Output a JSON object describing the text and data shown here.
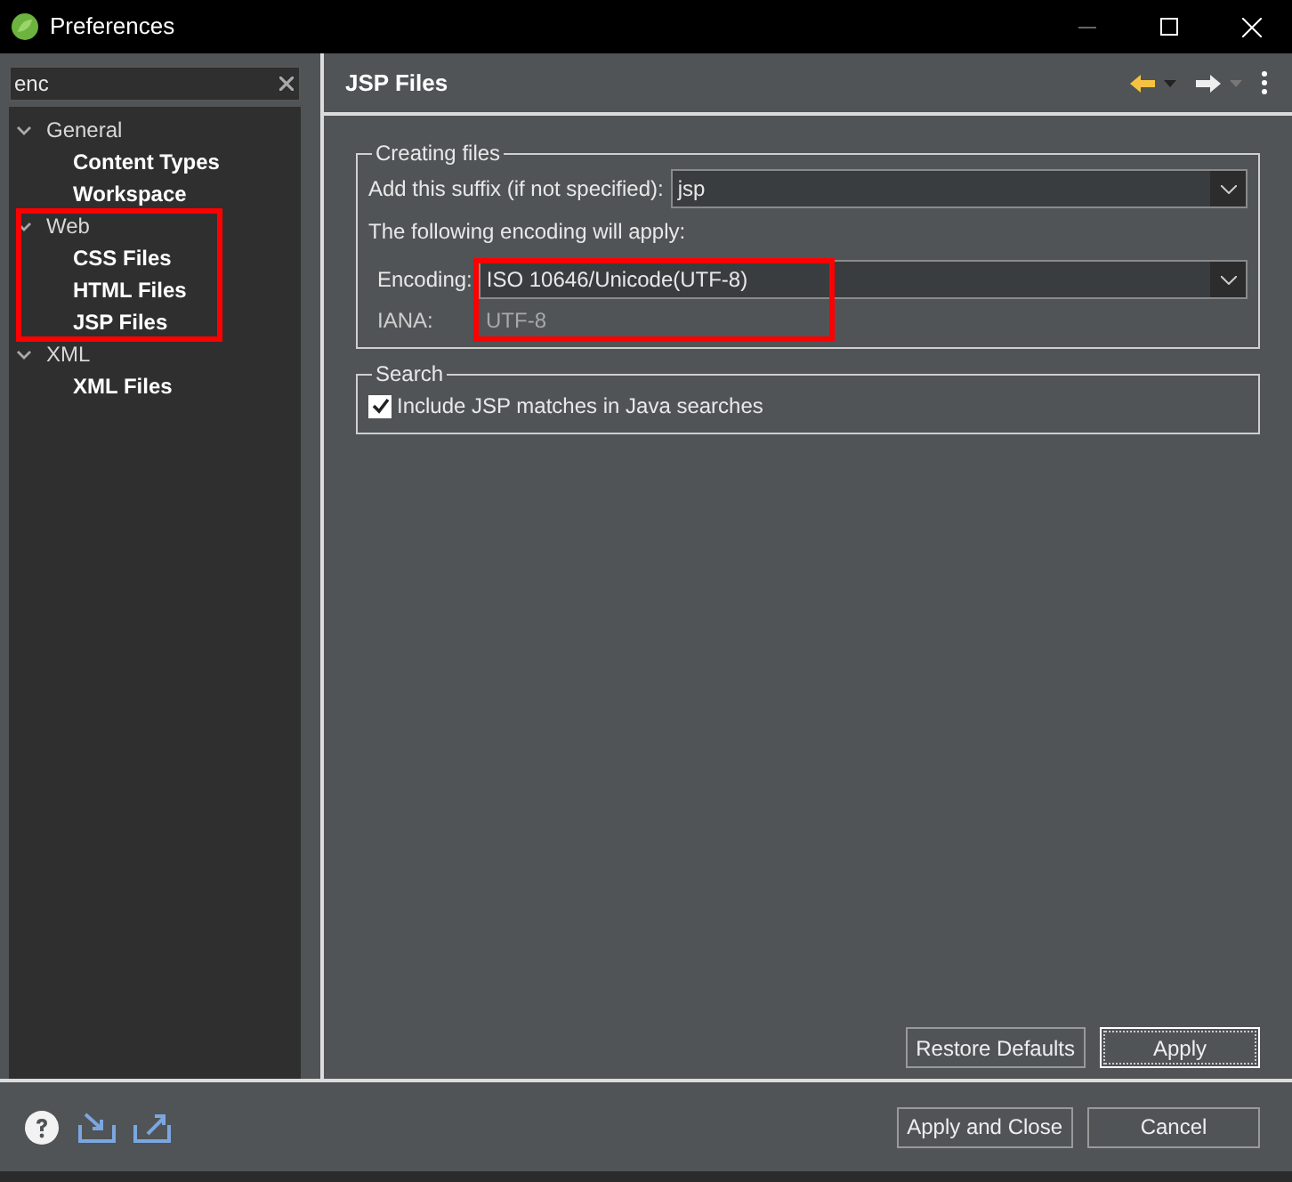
{
  "window": {
    "title": "Preferences"
  },
  "filter": {
    "value": "enc"
  },
  "tree": [
    {
      "label": "General",
      "expanded": true,
      "children": [
        {
          "label": "Content Types"
        },
        {
          "label": "Workspace"
        }
      ]
    },
    {
      "label": "Web",
      "expanded": true,
      "children": [
        {
          "label": "CSS Files"
        },
        {
          "label": "HTML Files"
        },
        {
          "label": "JSP Files"
        }
      ]
    },
    {
      "label": "XML",
      "expanded": true,
      "children": [
        {
          "label": "XML Files"
        }
      ]
    }
  ],
  "page": {
    "title": "JSP Files",
    "creating": {
      "legend": "Creating files",
      "suffix_label": "Add this suffix (if not specified):",
      "suffix": "jsp",
      "info": "The following encoding will apply:",
      "encoding_label": "Encoding:",
      "encoding": "ISO 10646/Unicode(UTF-8)",
      "iana_label": "IANA:",
      "iana": "UTF-8"
    },
    "search": {
      "legend": "Search",
      "option": {
        "label": "Include JSP matches in Java searches",
        "checked": true
      }
    },
    "buttons": [
      "Restore Defaults",
      "Apply"
    ]
  },
  "footer_buttons": [
    "Apply and Close",
    "Cancel"
  ]
}
